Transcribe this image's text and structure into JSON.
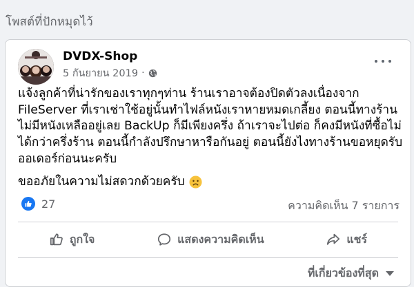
{
  "section": {
    "title": "โพสต์ที่ปักหมุดไว้"
  },
  "post": {
    "author": "DVDX-Shop",
    "date": "5 กันยายน 2019",
    "separator": "·",
    "privacy_icon": "globe-icon",
    "body": "แจ้งลูกค้าที่น่ารักของเราทุกๆท่าน ร้านเราอาจต้องปิดตัวลงเนื่องจาก\nFileServer ที่เราเช่าใช้อยู่นั้นทำไฟล์หนังเราหายหมดเกลี้ยง ตอนนี้ทางร้าน\nไม่มีหนังเหลืออยู่เลย BackUp ก็มีเพียงครึ่ง ถ้าเราจะไปต่อ ก็คงมีหนังที่ซื้อไม่\nได้กว่าครึ่งร้าน ตอนนี้กำลังปรึกษาหารือกันอยู่ ตอนนี้ยังไงทางร้านขอหยุดรับ\nออเดอร์ก่อนนะครับ",
    "apology": "ขออภัยในความไม่สดวกด้วยครับ",
    "emoji_icon": "sad-face-icon"
  },
  "stats": {
    "likes": "27",
    "comments": "ความคิดเห็น 7 รายการ"
  },
  "actions": {
    "like": "ถูกใจ",
    "comment": "แสดงความคิดเห็น",
    "share": "แชร์"
  },
  "sort": {
    "label": "ที่เกี่ยวข้องที่สุด"
  },
  "colors": {
    "accent": "#1877f2",
    "muted": "#65676b",
    "background": "#f0f2f5"
  }
}
